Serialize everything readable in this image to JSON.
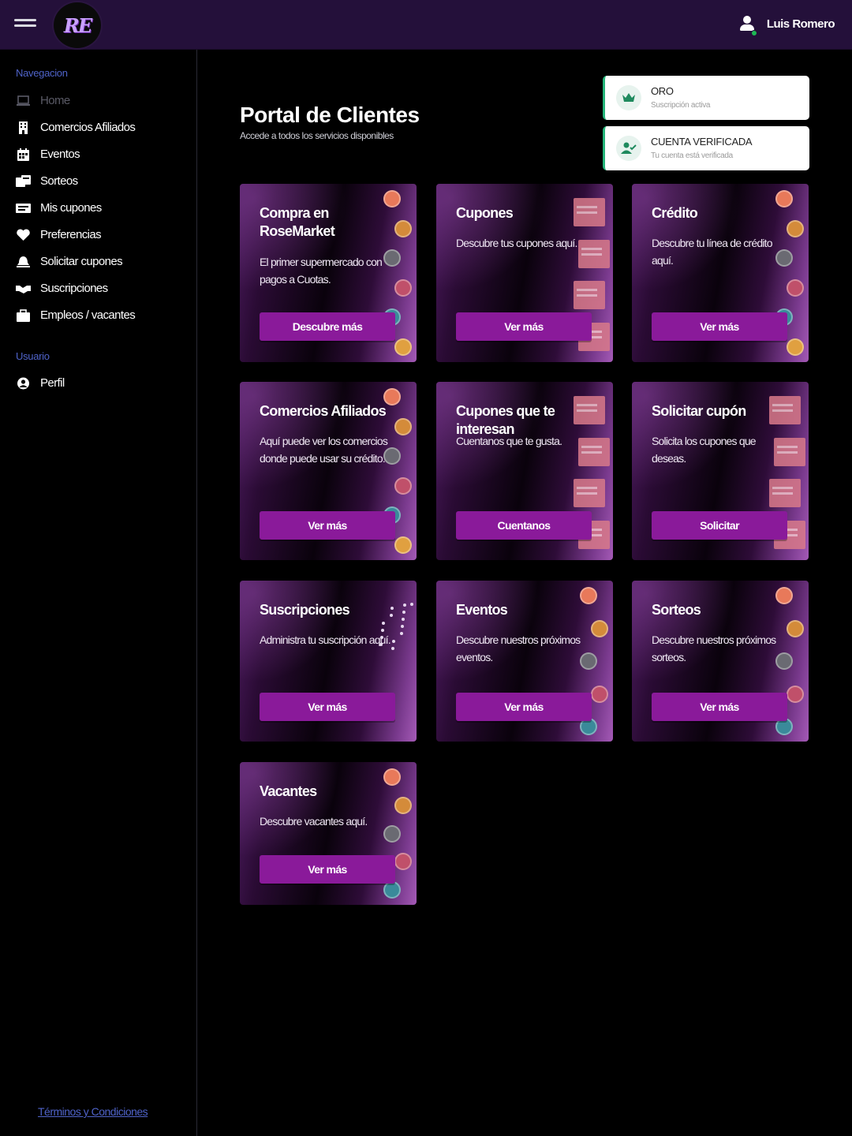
{
  "header": {
    "logo_text": "RE",
    "user_name": "Luis Romero"
  },
  "sidebar": {
    "nav_label": "Navegacion",
    "items": [
      {
        "label": "Home",
        "icon": "laptop-icon",
        "muted": true
      },
      {
        "label": "Comercios Afiliados",
        "icon": "building-icon"
      },
      {
        "label": "Eventos",
        "icon": "calendar-icon"
      },
      {
        "label": "Sorteos",
        "icon": "tickets-icon"
      },
      {
        "label": "Mis cupones",
        "icon": "coupon-icon"
      },
      {
        "label": "Preferencias",
        "icon": "heart-icon"
      },
      {
        "label": "Solicitar cupones",
        "icon": "bell-icon"
      },
      {
        "label": "Suscripciones",
        "icon": "handshake-icon"
      },
      {
        "label": "Empleos / vacantes",
        "icon": "briefcase-icon"
      }
    ],
    "user_label": "Usuario",
    "user_items": [
      {
        "label": "Perfil",
        "icon": "user-circle-icon"
      }
    ],
    "terms": "Términos y Condiciones"
  },
  "main": {
    "title": "Portal de Clientes",
    "subtitle": "Accede a todos los servicios disponibles",
    "status": [
      {
        "title": "ORO",
        "subtitle": "Suscripción activa",
        "icon": "crown-icon"
      },
      {
        "title": "CUENTA VERIFICADA",
        "subtitle": "Tu cuenta está verificada",
        "icon": "user-check-icon"
      }
    ],
    "cards": [
      {
        "title": "Compra en RoseMarket",
        "desc": "El primer supermercado con pagos a Cuotas.",
        "button": "Descubre más",
        "deco": "chips"
      },
      {
        "title": "Cupones",
        "desc": "Descubre tus cupones aquí.",
        "button": "Ver más",
        "deco": "tickets"
      },
      {
        "title": "Crédito",
        "desc": "Descubre tu línea de crédito aquí.",
        "button": "Ver más",
        "deco": "chips"
      },
      {
        "title": "Comercios Afiliados",
        "desc": "Aquí puede ver los comercios donde puede usar su crédito.",
        "button": "Ver más",
        "deco": "chips"
      },
      {
        "title": "Cupones que te interesan",
        "desc": "Cuentanos que te gusta.",
        "button": "Cuentanos",
        "deco": "tickets"
      },
      {
        "title": "Solicitar cupón",
        "desc": "Solicita los cupones que deseas.",
        "button": "Solicitar",
        "deco": "tickets"
      },
      {
        "title": "Suscripciones",
        "desc": "Administra tu suscripción aquí.",
        "button": "Ver más",
        "deco": "dots"
      },
      {
        "title": "Eventos",
        "desc": "Descubre nuestros próximos eventos.",
        "button": "Ver más",
        "deco": "chips"
      },
      {
        "title": "Sorteos",
        "desc": "Descubre nuestros próximos sorteos.",
        "button": "Ver más",
        "deco": "chips"
      },
      {
        "title": "Vacantes",
        "desc": "Descubre vacantes aquí.",
        "button": "Ver más",
        "deco": "chips"
      }
    ]
  }
}
